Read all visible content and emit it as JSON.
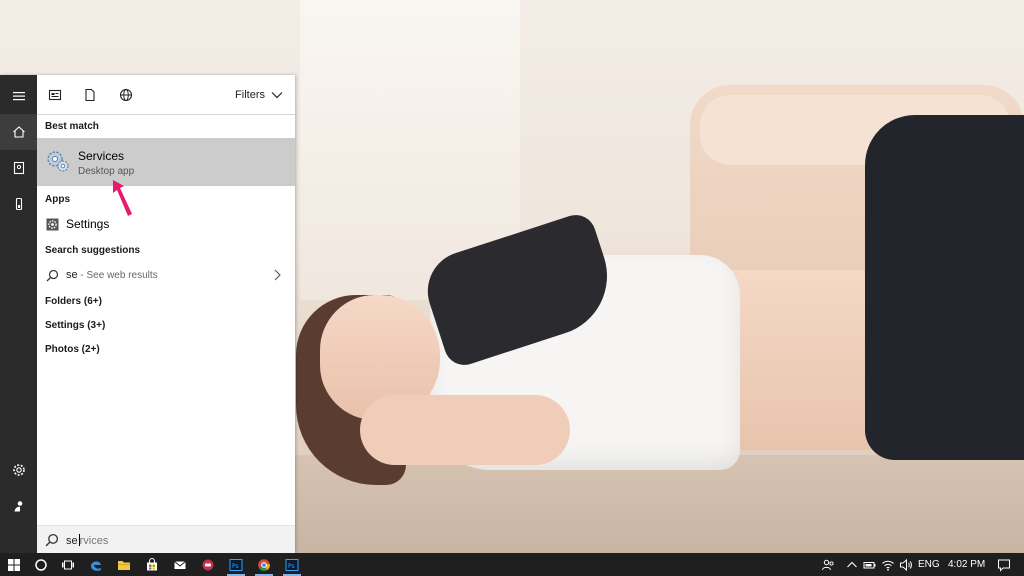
{
  "start_menu": {
    "filters_label": "Filters",
    "best_match_heading": "Best match",
    "best_match": {
      "title": "Services",
      "subtitle": "Desktop app"
    },
    "apps_heading": "Apps",
    "apps": [
      {
        "label": "Settings"
      }
    ],
    "suggestions_heading": "Search suggestions",
    "suggestion": {
      "query": "se",
      "hint": " - See web results"
    },
    "categories": [
      {
        "label": "Folders (6+)"
      },
      {
        "label": "Settings (3+)"
      },
      {
        "label": "Photos (2+)"
      }
    ],
    "search": {
      "typed": "se",
      "completion": "rvices"
    }
  },
  "taskbar": {
    "pinned": [
      "start-icon",
      "cortana-icon",
      "task-view-icon",
      "edge-icon",
      "file-explorer-icon",
      "store-icon",
      "mail-icon",
      "app-icon",
      "photoshop-icon",
      "chrome-icon",
      "photoshop-icon"
    ],
    "tray": {
      "language": "ENG",
      "time": "4:02 PM"
    }
  },
  "colors": {
    "rail_bg": "#2b2b2b",
    "selected_bg": "#cccccc",
    "taskbar_bg": "#1f1f1f",
    "pointer": "#e8196e"
  }
}
